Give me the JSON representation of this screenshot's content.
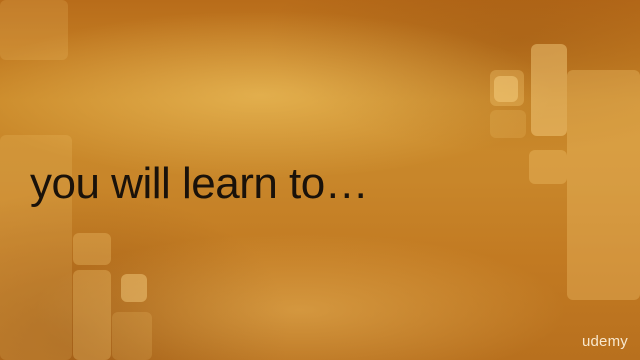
{
  "slide": {
    "headline": "you will learn to…",
    "brand": "udemy"
  },
  "colors": {
    "background_top": "#b86c1a",
    "background_mid": "#cb8a2a",
    "text": "#1a120a",
    "brand": "#fff5e1"
  }
}
